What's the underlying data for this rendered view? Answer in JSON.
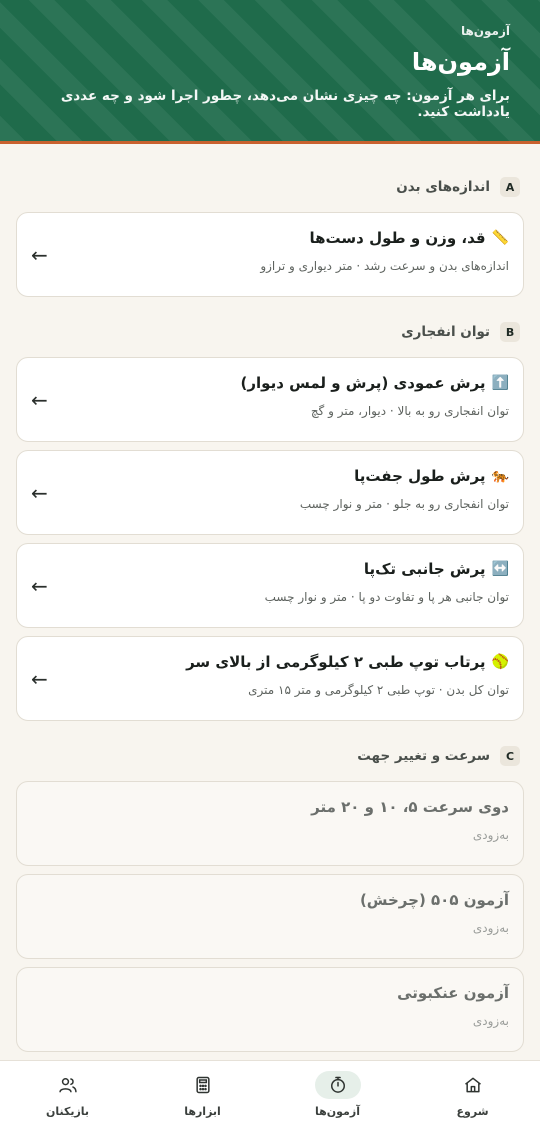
{
  "header": {
    "breadcrumb": "آزمون‌ها",
    "title": "آزمون‌ها",
    "subtitle": "برای هر آزمون: چه چیزی نشان می‌دهد، چطور اجرا شود و چه عددی یادداشت کنید."
  },
  "sections": [
    {
      "letter": "A",
      "title": "اندازه‌های بدن",
      "cards": [
        {
          "icon": "📏",
          "title": "قد، وزن و طول دست‌ها",
          "subtitle": "اندازه‌های بدن و سرعت رشد · متر دیواری و ترازو",
          "arrow": "←"
        }
      ]
    },
    {
      "letter": "B",
      "title": "توان انفجاری",
      "cards": [
        {
          "icon": "⬆️",
          "title": "پرش عمودی (پرش و لمس دیوار)",
          "subtitle": "توان انفجاری رو به بالا · دیوار، متر و گچ",
          "arrow": "←"
        },
        {
          "icon": "🐅",
          "title": "پرش طول جفت‌پا",
          "subtitle": "توان انفجاری رو به جلو · متر و نوار چسب",
          "arrow": "←"
        },
        {
          "icon": "↔️",
          "title": "پرش جانبی تک‌پا",
          "subtitle": "توان جانبی هر پا و تفاوت دو پا · متر و نوار چسب",
          "arrow": "←"
        },
        {
          "icon": "🥎",
          "title": "پرتاب توپ طبی ۲ کیلوگرمی از بالای سر",
          "subtitle": "توان کل بدن · توپ طبی ۲ کیلوگرمی و متر ۱۵ متری",
          "arrow": "←"
        }
      ]
    },
    {
      "letter": "C",
      "title": "سرعت و تغییر جهت",
      "cards": [
        {
          "title": "دوی سرعت ۵، ۱۰ و ۲۰ متر",
          "subtitle": "به‌زودی"
        },
        {
          "title": "آزمون ۵۰۵ (چرخش)",
          "subtitle": "به‌زودی"
        },
        {
          "title": "آزمون عنکبوتی",
          "subtitle": "به‌زودی"
        }
      ]
    }
  ],
  "nav": [
    {
      "label": "شروع",
      "icon": "home-icon"
    },
    {
      "label": "آزمون‌ها",
      "icon": "stopwatch-icon"
    },
    {
      "label": "ابزارها",
      "icon": "calculator-icon"
    },
    {
      "label": "بازیکنان",
      "icon": "users-icon"
    }
  ]
}
